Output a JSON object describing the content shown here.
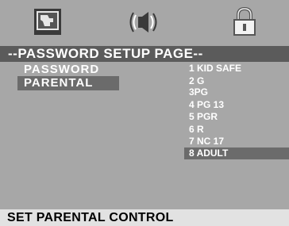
{
  "tabs": [
    {
      "icon": "general-setup-icon"
    },
    {
      "icon": "audio-setup-icon"
    },
    {
      "icon": "lock-icon",
      "selected": true
    }
  ],
  "title": "--PASSWORD SETUP PAGE--",
  "menu": [
    {
      "label": "PASSWORD"
    },
    {
      "label": "PARENTAL",
      "selected": true
    }
  ],
  "options": [
    {
      "label": "1 KID SAFE"
    },
    {
      "label": "2 G"
    },
    {
      "label": "3PG"
    },
    {
      "label": "4 PG 13"
    },
    {
      "label": "5 PGR"
    },
    {
      "label": "6 R"
    },
    {
      "label": "7 NC 17"
    },
    {
      "label": "8 ADULT",
      "selected": true
    }
  ],
  "status": "SET PARENTAL CONTROL",
  "colors": {
    "background": "#a7a7a7",
    "title_bar": "#5b5b5b",
    "highlight": "#6b6b6b",
    "status_bar": "#e2e2e2",
    "text": "#ffffff"
  }
}
